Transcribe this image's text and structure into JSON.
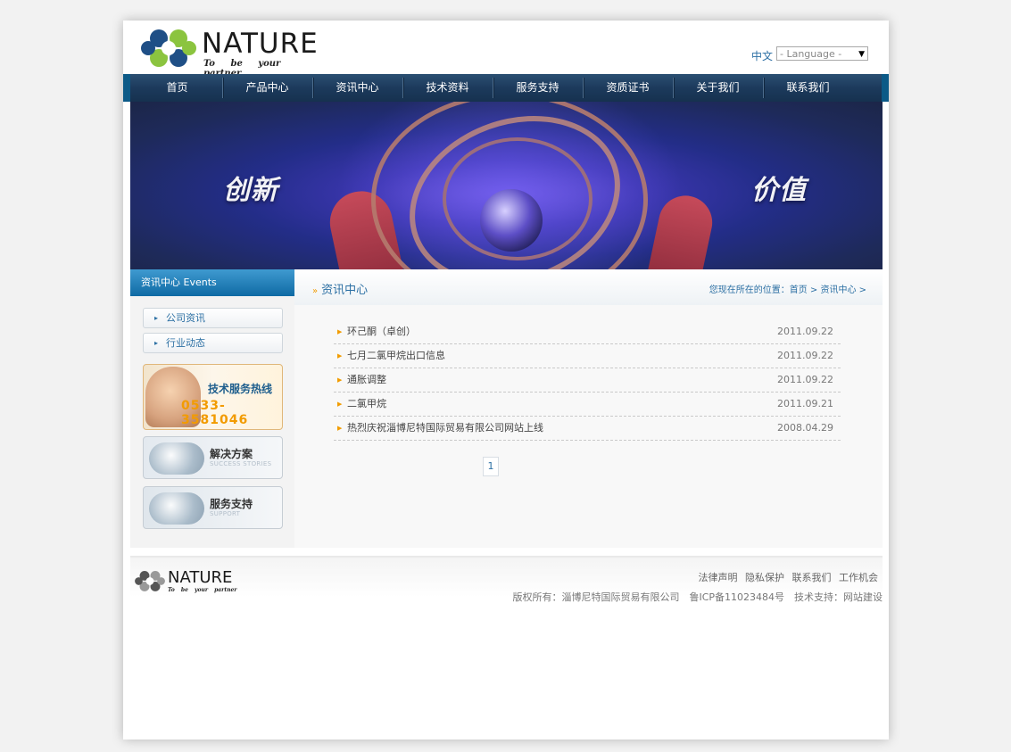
{
  "brand": {
    "name": "NATURE",
    "tagline": "To be your partner",
    "colors": {
      "green": "#8bc43f",
      "blue": "#1f4f86",
      "accent": "#f29b00",
      "link": "#2b6fa3"
    }
  },
  "header": {
    "lang_link": "中文",
    "lang_select": "- Language -"
  },
  "nav": {
    "items": [
      "首页",
      "产品中心",
      "资讯中心",
      "技术资料",
      "服务支持",
      "资质证书",
      "关于我们",
      "联系我们"
    ]
  },
  "banner": {
    "left_text": "创新",
    "right_text": "价值"
  },
  "sidebar": {
    "title": "资讯中心 Events",
    "links": [
      "公司资讯",
      "行业动态"
    ],
    "hotline": {
      "label": "技术服务热线",
      "number": "0533-3581046"
    },
    "solutions": {
      "label": "解决方案",
      "sub": "SUCCESS STORIES"
    },
    "support": {
      "label": "服务支持",
      "sub": "SUPPORT"
    }
  },
  "main": {
    "title": "资讯中心",
    "breadcrumb": "您现在所在的位置：首页 > 资讯中心 >",
    "news": [
      {
        "title": "环己酮（卓创）",
        "date": "2011.09.22"
      },
      {
        "title": "七月二氯甲烷出口信息",
        "date": "2011.09.22"
      },
      {
        "title": "通胀调整",
        "date": "2011.09.22"
      },
      {
        "title": "二氯甲烷",
        "date": "2011.09.21"
      },
      {
        "title": "热烈庆祝淄博尼特国际贸易有限公司网站上线",
        "date": "2008.04.29"
      }
    ],
    "page": "1"
  },
  "footer": {
    "links": [
      "法律声明",
      "隐私保护",
      "联系我们",
      "工作机会"
    ],
    "copyright": "版权所有：淄博尼特国际贸易有限公司　鲁ICP备11023484号　技术支持：网站建设"
  }
}
